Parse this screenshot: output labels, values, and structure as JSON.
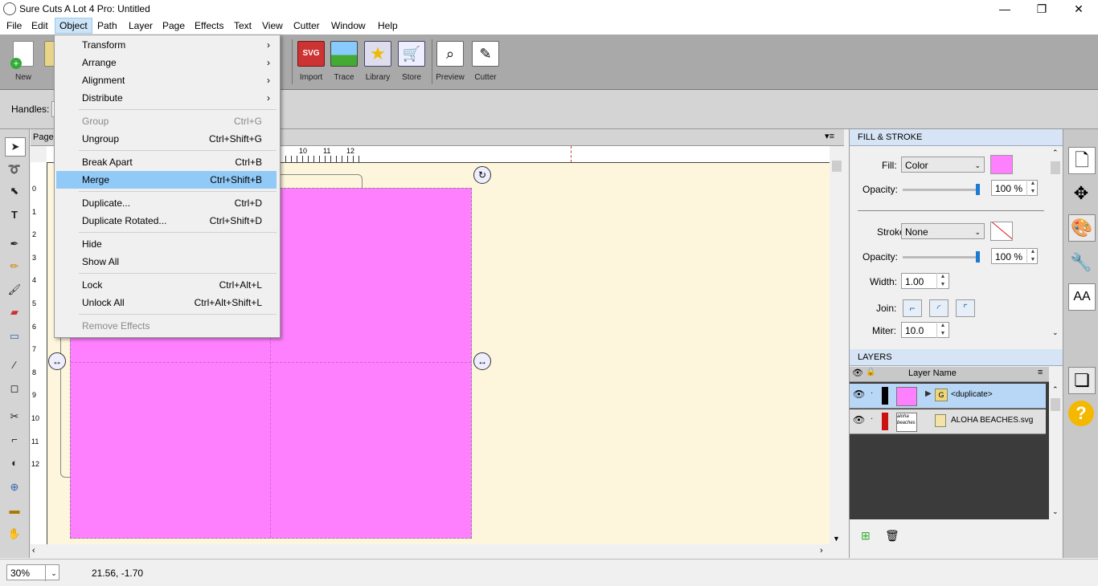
{
  "window": {
    "title": "Sure Cuts A Lot 4 Pro: Untitled",
    "minimize": "—",
    "maximize": "❐",
    "close": "✕"
  },
  "menubar": [
    "File",
    "Edit",
    "Object",
    "Path",
    "Layer",
    "Page",
    "Effects",
    "Text",
    "View",
    "Cutter",
    "Window",
    "Help"
  ],
  "toolbar": {
    "new": "New",
    "open": "O",
    "import": "Import",
    "trace": "Trace",
    "library": "Library",
    "store": "Store",
    "preview": "Preview",
    "cutter": "Cutter"
  },
  "handles": {
    "label": "Handles:"
  },
  "page_tab": "Page",
  "ruler": {
    "top": [
      "10",
      "11",
      "12"
    ],
    "left": [
      "0",
      "1",
      "2",
      "3",
      "4",
      "5",
      "6",
      "7",
      "8",
      "9",
      "10",
      "11",
      "12"
    ]
  },
  "object_menu": {
    "transform": "Transform",
    "arrange": "Arrange",
    "alignment": "Alignment",
    "distribute": "Distribute",
    "group": "Group",
    "group_sc": "Ctrl+G",
    "ungroup": "Ungroup",
    "ungroup_sc": "Ctrl+Shift+G",
    "break_apart": "Break Apart",
    "break_apart_sc": "Ctrl+B",
    "merge": "Merge",
    "merge_sc": "Ctrl+Shift+B",
    "duplicate": "Duplicate...",
    "duplicate_sc": "Ctrl+D",
    "duplicate_rotated": "Duplicate Rotated...",
    "duplicate_rotated_sc": "Ctrl+Shift+D",
    "hide": "Hide",
    "show_all": "Show All",
    "lock": "Lock",
    "lock_sc": "Ctrl+Alt+L",
    "unlock_all": "Unlock All",
    "unlock_all_sc": "Ctrl+Alt+Shift+L",
    "remove_effects": "Remove Effects",
    "submenu_arrow": "›"
  },
  "fill_stroke": {
    "header": "FILL & STROKE",
    "fill_label": "Fill:",
    "fill_value": "Color",
    "fill_color": "#ff80ff",
    "opacity_label": "Opacity:",
    "opacity_value": "100 %",
    "stroke_label": "Stroke:",
    "stroke_value": "None",
    "stroke_opacity_value": "100 %",
    "width_label": "Width:",
    "width_value": "1.00",
    "join_label": "Join:",
    "miter_label": "Miter:",
    "miter_value": "10.0"
  },
  "layers": {
    "header": "LAYERS",
    "col_name": "Layer Name",
    "rows": [
      {
        "name": "<duplicate>",
        "group_badge": "G",
        "swatch": "#ff80ff",
        "color": "#000000"
      },
      {
        "name": "ALOHA BEACHES.svg",
        "swatch": "#ffffff",
        "color": "#cc1111",
        "thumb_text": "aloha beaches"
      }
    ]
  },
  "status": {
    "zoom": "30%",
    "coords": "21.56, -1.70"
  },
  "colors": {
    "shape_fill": "#ff80ff",
    "canvas": "#fdf6dc",
    "highlight": "#91c9f7"
  }
}
